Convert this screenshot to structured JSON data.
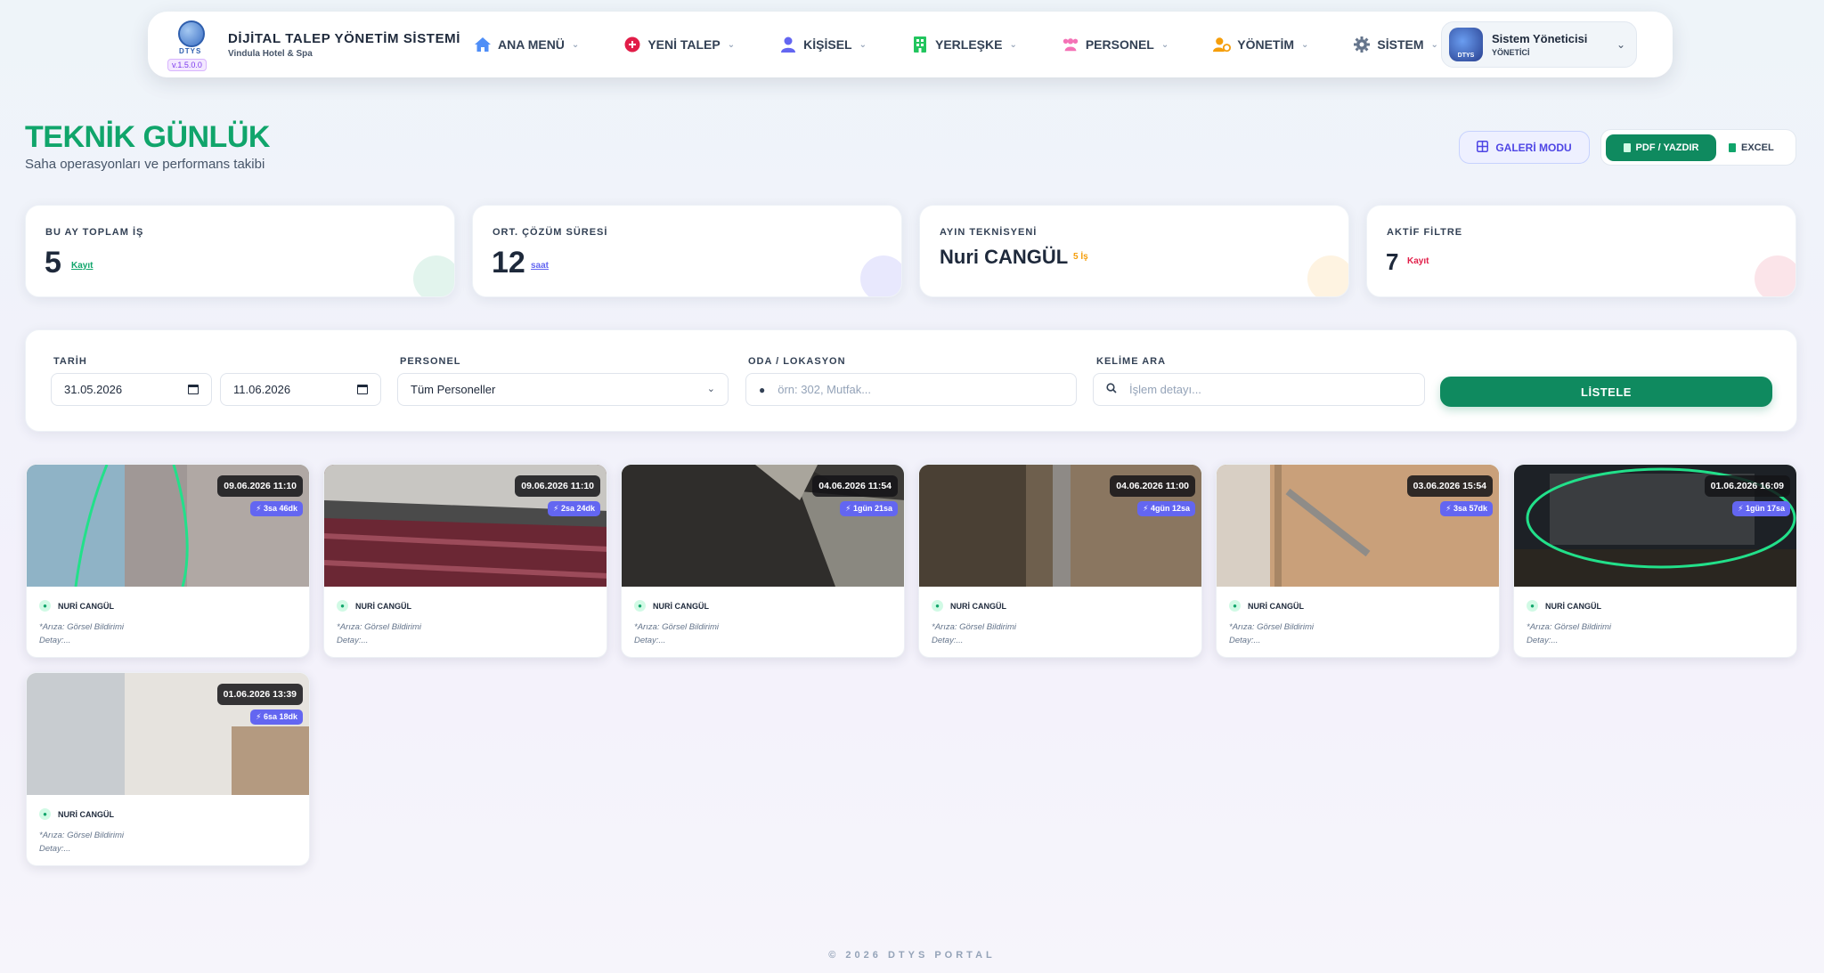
{
  "nav": {
    "brand_title": "DİJİTAL TALEP YÖNETİM SİSTEMİ",
    "brand_sub": "Vindula Hotel & Spa",
    "logo_text": "DTYS",
    "version": "v.1.5.0.0",
    "items": [
      {
        "label": "ANA MENÜ",
        "icon": "home-icon",
        "color": "#4f8ef7"
      },
      {
        "label": "YENİ TALEP",
        "icon": "plus-circle-icon",
        "color": "#e11d48"
      },
      {
        "label": "KİŞİSEL",
        "icon": "user-icon",
        "color": "#6366f1"
      },
      {
        "label": "YERLEŞKE",
        "icon": "building-icon",
        "color": "#22c55e"
      },
      {
        "label": "PERSONEL",
        "icon": "users-icon",
        "color": "#f472b6"
      },
      {
        "label": "YÖNETİM",
        "icon": "user-cog-icon",
        "color": "#f59e0b"
      },
      {
        "label": "SİSTEM",
        "icon": "gear-icon",
        "color": "#64748b"
      }
    ],
    "user_name": "Sistem Yöneticisi",
    "user_role": "YÖNETİCİ"
  },
  "header": {
    "title": "TEKNİK GÜNLÜK",
    "subtitle": "Saha operasyonları ve performans takibi",
    "gallery_btn": "GALERİ MODU",
    "pdf_btn": "PDF / YAZDIR",
    "excel_btn": "EXCEL"
  },
  "stats": [
    {
      "label": "BU AY TOPLAM İŞ",
      "value": "5",
      "unit": "Kayıt",
      "unit_color": "#10a56b"
    },
    {
      "label": "ORT. ÇÖZÜM SÜRESİ",
      "value": "12",
      "unit": "saat",
      "unit_color": "#6366f1"
    },
    {
      "label": "AYIN TEKNİSYENİ",
      "value": "Nuri CANGÜL",
      "unit": "5 İş",
      "unit_color": "#f59e0b"
    },
    {
      "label": "AKTİF FİLTRE",
      "value": "7",
      "unit": "Kayıt",
      "unit_color": "#e11d48"
    }
  ],
  "filter": {
    "date_label": "TARİH",
    "date_from": "31.05.2026",
    "date_to": "11.06.2026",
    "personel_label": "PERSONEL",
    "personel_value": "Tüm Personeller",
    "oda_label": "ODA / LOKASYON",
    "oda_placeholder": "örn: 302, Mutfak...",
    "kelime_label": "KELİME ARA",
    "kelime_placeholder": "İşlem detayı...",
    "list_btn": "LİSTELE"
  },
  "cards": [
    {
      "date": "09.06.2026 11:10",
      "duration": "⚡ 3sa 46dk",
      "tech": "NURİ CANGÜL",
      "desc1": "*Arıza: Görsel Bildirimi",
      "desc2": "Detay:..."
    },
    {
      "date": "09.06.2026 11:10",
      "duration": "⚡ 2sa 24dk",
      "tech": "NURİ CANGÜL",
      "desc1": "*Arıza: Görsel Bildirimi",
      "desc2": "Detay:..."
    },
    {
      "date": "04.06.2026 11:54",
      "duration": "⚡ 1gün 21sa",
      "tech": "NURİ CANGÜL",
      "desc1": "*Arıza: Görsel Bildirimi",
      "desc2": "Detay:..."
    },
    {
      "date": "04.06.2026 11:00",
      "duration": "⚡ 4gün 12sa",
      "tech": "NURİ CANGÜL",
      "desc1": "*Arıza: Görsel Bildirimi",
      "desc2": "Detay:..."
    },
    {
      "date": "03.06.2026 15:54",
      "duration": "⚡ 3sa 57dk",
      "tech": "NURİ CANGÜL",
      "desc1": "*Arıza: Görsel Bildirimi",
      "desc2": "Detay:..."
    },
    {
      "date": "01.06.2026 16:09",
      "duration": "⚡ 1gün 17sa",
      "tech": "NURİ CANGÜL",
      "desc1": "*Arıza: Görsel Bildirimi",
      "desc2": "Detay:..."
    },
    {
      "date": "01.06.2026 13:39",
      "duration": "⚡ 6sa 18dk",
      "tech": "NURİ CANGÜL",
      "desc1": "*Arıza: Görsel Bildirimi",
      "desc2": "Detay:..."
    }
  ],
  "footer": "© 2026 DTYS PORTAL"
}
